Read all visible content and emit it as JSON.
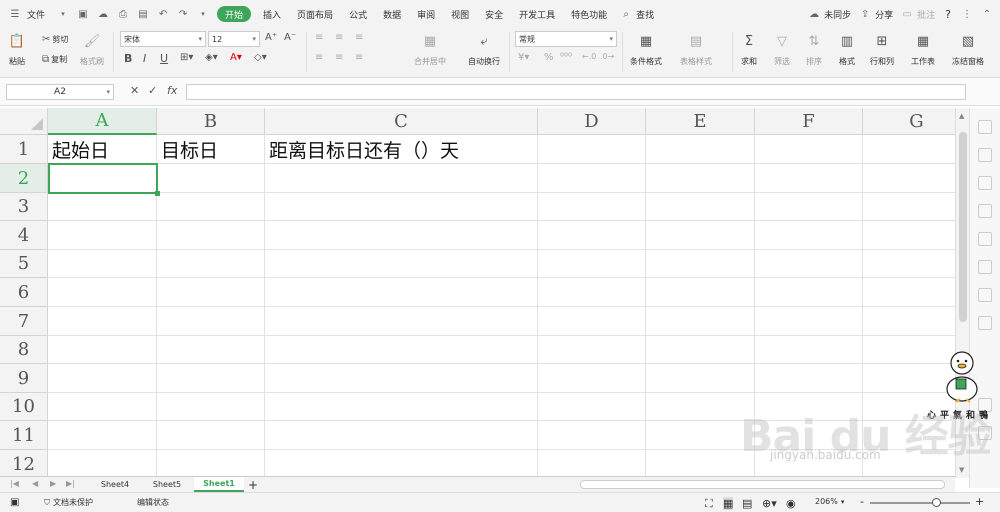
{
  "menubar": {
    "file_label": "文件",
    "tabs": [
      "开始",
      "插入",
      "页面布局",
      "公式",
      "数据",
      "审阅",
      "视图",
      "安全",
      "开发工具",
      "特色功能"
    ],
    "active_tab": "开始",
    "search_label": "查找",
    "sync_label": "未同步",
    "share_label": "分享",
    "comment_label": "批注",
    "help_label": "?"
  },
  "ribbon": {
    "paste": "粘贴",
    "cut": "剪切",
    "copy": "复制",
    "format_painter": "格式刷",
    "font_name": "宋体",
    "font_size": "12",
    "bold": "B",
    "italic": "I",
    "underline": "U",
    "merge_center": "合并居中",
    "wrap_text": "自动换行",
    "number_format": "常规",
    "percent": "%",
    "cond_format": "条件格式",
    "table_style": "表格样式",
    "sum": "求和",
    "filter": "筛选",
    "sort": "排序",
    "format": "格式",
    "row_col": "行和列",
    "worksheet": "工作表",
    "freeze": "冻结窗格"
  },
  "formula_bar": {
    "cell_ref": "A2",
    "fx_label": "fx",
    "content": ""
  },
  "grid": {
    "columns": [
      "A",
      "B",
      "C",
      "D",
      "E",
      "F",
      "G"
    ],
    "rows": [
      "1",
      "2",
      "3",
      "4",
      "5",
      "6",
      "7",
      "8",
      "9",
      "10",
      "11",
      "12"
    ],
    "cells": {
      "A1": "起始日",
      "B1": "目标日",
      "C1": "距离目标日还有（）天"
    },
    "active_cell": "A2",
    "accent_color": "#3ea55b"
  },
  "sheets": {
    "tabs": [
      "Sheet4",
      "Sheet5",
      "Sheet1"
    ],
    "active": "Sheet1",
    "add_label": "+"
  },
  "status": {
    "protect": "文档未保护",
    "mode": "编辑状态",
    "zoom": "206%",
    "zoom_minus": "-",
    "zoom_plus": "+"
  },
  "watermark": {
    "text": "Bai du 经验",
    "sub": "jingyan.baidu.com",
    "duck_caption": "心平氣和鴨"
  }
}
